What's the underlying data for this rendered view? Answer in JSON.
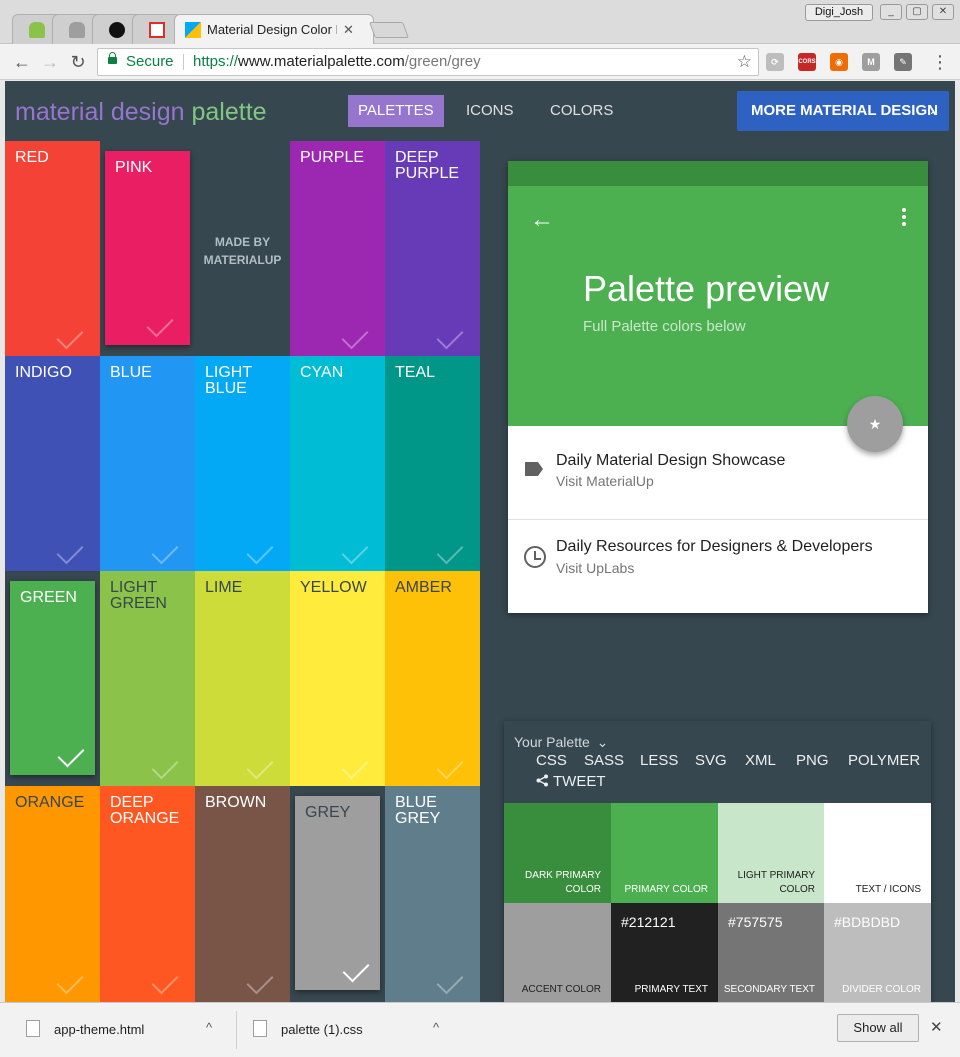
{
  "browser": {
    "active_tab_title": "Material Design Color P",
    "tab_close": "✕",
    "user_name": "Digi_Josh",
    "window_buttons": [
      "_",
      "▢",
      "✕"
    ],
    "secure_label": "Secure",
    "url_scheme": "https://",
    "url_host": "www.materialpalette.com",
    "url_path": "/green/grey",
    "back": "←",
    "forward": "→",
    "reload": "↻",
    "star": "☆",
    "menu": "⋮",
    "extensions": [
      {
        "name": "link-extension-icon",
        "text": "⟳",
        "bg": "#bdbdbd"
      },
      {
        "name": "cors-extension-icon",
        "text": "CORS",
        "bg": "#c62828"
      },
      {
        "name": "orange-extension-icon",
        "text": "◉",
        "bg": "#ef6c00"
      },
      {
        "name": "m-extension-icon",
        "text": "M",
        "bg": "#9e9e9e"
      },
      {
        "name": "eyedropper-extension-icon",
        "text": "✎",
        "bg": "#757575"
      }
    ]
  },
  "site": {
    "logo_word1": "material design",
    "logo_word2": "palette",
    "nav": [
      "PALETTES",
      "ICONS",
      "COLORS"
    ],
    "more_button": "MORE MATERIAL DESIGN",
    "more_chevron": "›",
    "grid": [
      {
        "label": "RED",
        "color": "#f44336",
        "text": "#fff"
      },
      {
        "label": "PINK",
        "color": "#e91e63",
        "text": "#fff",
        "inset": true
      },
      {
        "label": "MADE BY MATERIALUP",
        "color": "#37474f",
        "text": "#b0bec5",
        "madeby": true
      },
      {
        "label": "PURPLE",
        "color": "#9c27b0",
        "text": "#fff"
      },
      {
        "label": "DEEP PURPLE",
        "color": "#673ab7",
        "text": "#fff"
      },
      {
        "label": "INDIGO",
        "color": "#3f51b5",
        "text": "#fff"
      },
      {
        "label": "BLUE",
        "color": "#2196f3",
        "text": "#fff"
      },
      {
        "label": "LIGHT BLUE",
        "color": "#03a9f4",
        "text": "#fff"
      },
      {
        "label": "CYAN",
        "color": "#00bcd4",
        "text": "#fff"
      },
      {
        "label": "TEAL",
        "color": "#009688",
        "text": "#fff"
      },
      {
        "label": "GREEN",
        "color": "#4caf50",
        "text": "#fff",
        "inset": true,
        "selected": true
      },
      {
        "label": "LIGHT GREEN",
        "color": "#8bc34a",
        "text": "#37474f"
      },
      {
        "label": "LIME",
        "color": "#cddc39",
        "text": "#37474f"
      },
      {
        "label": "YELLOW",
        "color": "#ffeb3b",
        "text": "#37474f"
      },
      {
        "label": "AMBER",
        "color": "#ffc107",
        "text": "#37474f"
      },
      {
        "label": "ORANGE",
        "color": "#ff9800",
        "text": "#37474f"
      },
      {
        "label": "DEEP ORANGE",
        "color": "#ff5722",
        "text": "#fff"
      },
      {
        "label": "BROWN",
        "color": "#795548",
        "text": "#fff"
      },
      {
        "label": "GREY",
        "color": "#9e9e9e",
        "text": "#37474f",
        "inset": true,
        "selected": true
      },
      {
        "label": "BLUE GREY",
        "color": "#607d8b",
        "text": "#fff"
      }
    ],
    "preview": {
      "back_arrow": "←",
      "title": "Palette preview",
      "subtitle": "Full Palette colors below",
      "fab": "★",
      "items": [
        {
          "title": "Daily Material Design Showcase",
          "subtitle": "Visit MaterialUp",
          "icon": "label-icon"
        },
        {
          "title": "Daily Resources for Designers & Developers",
          "subtitle": "Visit UpLabs",
          "icon": "clock-icon"
        }
      ]
    },
    "palette_panel": {
      "title": "Your Palette",
      "caret": "⌄",
      "formats": [
        "CSS",
        "SASS",
        "LESS",
        "SVG",
        "XML",
        "PNG",
        "POLYMER"
      ],
      "tweet": "TWEET",
      "swatches": [
        {
          "name": "DARK PRIMARY COLOR",
          "hex": "",
          "bg": "#388e3c",
          "fg": "#fff"
        },
        {
          "name": "PRIMARY COLOR",
          "hex": "",
          "bg": "#4caf50",
          "fg": "#fff"
        },
        {
          "name": "LIGHT PRIMARY COLOR",
          "hex": "",
          "bg": "#c8e6c9",
          "fg": "#212121"
        },
        {
          "name": "TEXT / ICONS",
          "hex": "",
          "bg": "#ffffff",
          "fg": "#212121"
        },
        {
          "name": "ACCENT COLOR",
          "hex": "",
          "bg": "#9e9e9e",
          "fg": "#212121"
        },
        {
          "name": "PRIMARY TEXT",
          "hex": "#212121",
          "bg": "#212121",
          "fg": "#fff"
        },
        {
          "name": "SECONDARY TEXT",
          "hex": "#757575",
          "bg": "#757575",
          "fg": "#fff"
        },
        {
          "name": "DIVIDER COLOR",
          "hex": "#BDBDBD",
          "bg": "#bdbdbd",
          "fg": "#fff"
        }
      ]
    }
  },
  "downloads": {
    "items": [
      "app-theme.html",
      "palette (1).css"
    ],
    "caret": "^",
    "show_all": "Show all",
    "close": "✕"
  }
}
